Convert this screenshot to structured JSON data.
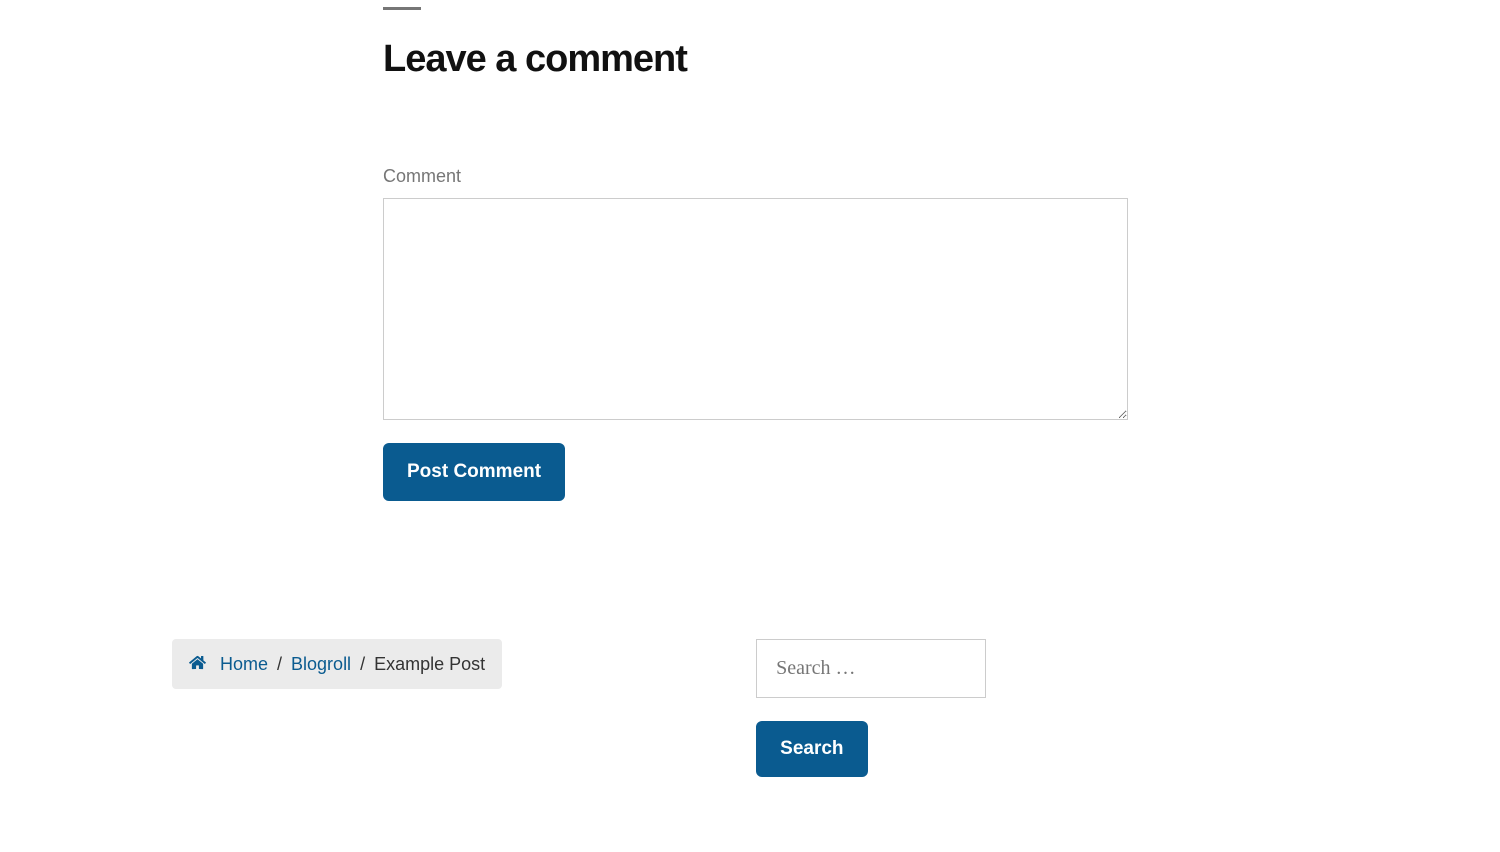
{
  "comment_form": {
    "heading": "Leave a comment",
    "label": "Comment",
    "submit_label": "Post Comment"
  },
  "breadcrumb": {
    "items": [
      {
        "label": "Home",
        "link": true
      },
      {
        "label": "Blogroll",
        "link": true
      },
      {
        "label": "Example Post",
        "link": false
      }
    ]
  },
  "search": {
    "placeholder": "Search …",
    "button_label": "Search"
  }
}
